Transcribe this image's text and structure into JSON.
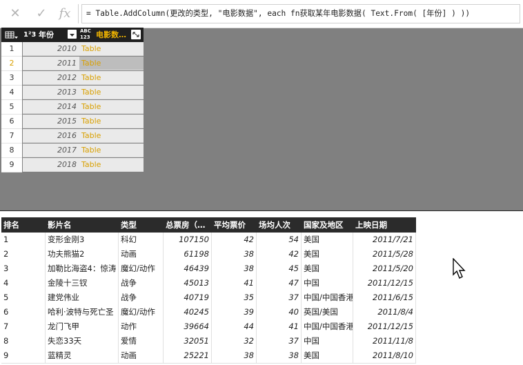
{
  "formula": {
    "cancel_icon": "close-icon",
    "confirm_icon": "check-icon",
    "fx_label": "fx",
    "text": "= Table.AddColumn(更改的类型, \"电影数据\", each fn获取某年电影数据( Text.From( [年份] ) ))"
  },
  "query_table": {
    "col_year_type": "1²3",
    "col_year": "年份",
    "col_data_type": "ABC 123",
    "col_data": "电影数…",
    "rows": [
      {
        "n": "1",
        "year": "2010",
        "val": "Table"
      },
      {
        "n": "2",
        "year": "2011",
        "val": "Table",
        "selected": true
      },
      {
        "n": "3",
        "year": "2012",
        "val": "Table"
      },
      {
        "n": "4",
        "year": "2013",
        "val": "Table"
      },
      {
        "n": "5",
        "year": "2014",
        "val": "Table"
      },
      {
        "n": "6",
        "year": "2015",
        "val": "Table"
      },
      {
        "n": "7",
        "year": "2016",
        "val": "Table"
      },
      {
        "n": "8",
        "year": "2017",
        "val": "Table"
      },
      {
        "n": "9",
        "year": "2018",
        "val": "Table"
      }
    ]
  },
  "preview_table": {
    "headers": [
      "排名",
      "影片名",
      "类型",
      "总票房（…",
      "平均票价",
      "场均人次",
      "国家及地区",
      "上映日期"
    ],
    "rows": [
      [
        "1",
        "变形金刚3",
        "科幻",
        "107150",
        "42",
        "54",
        "美国",
        "2011/7/21"
      ],
      [
        "2",
        "功夫熊猫2",
        "动画",
        "61198",
        "38",
        "42",
        "美国",
        "2011/5/28"
      ],
      [
        "3",
        "加勒比海盗4：惊涛",
        "魔幻/动作",
        "46439",
        "38",
        "45",
        "美国",
        "2011/5/20"
      ],
      [
        "4",
        "金陵十三钗",
        "战争",
        "45013",
        "41",
        "47",
        "中国",
        "2011/12/15"
      ],
      [
        "5",
        "建党伟业",
        "战争",
        "40719",
        "35",
        "37",
        "中国/中国香港",
        "2011/6/15"
      ],
      [
        "6",
        "哈利·波特与死亡圣",
        "魔幻/动作",
        "40245",
        "39",
        "40",
        "英国/美国",
        "2011/8/4"
      ],
      [
        "7",
        "龙门飞甲",
        "动作",
        "39664",
        "44",
        "41",
        "中国/中国香港",
        "2011/12/15"
      ],
      [
        "8",
        "失恋33天",
        "爱情",
        "32051",
        "32",
        "37",
        "中国",
        "2011/11/8"
      ],
      [
        "9",
        "蓝精灵",
        "动画",
        "25221",
        "38",
        "38",
        "美国",
        "2011/8/10"
      ]
    ]
  }
}
